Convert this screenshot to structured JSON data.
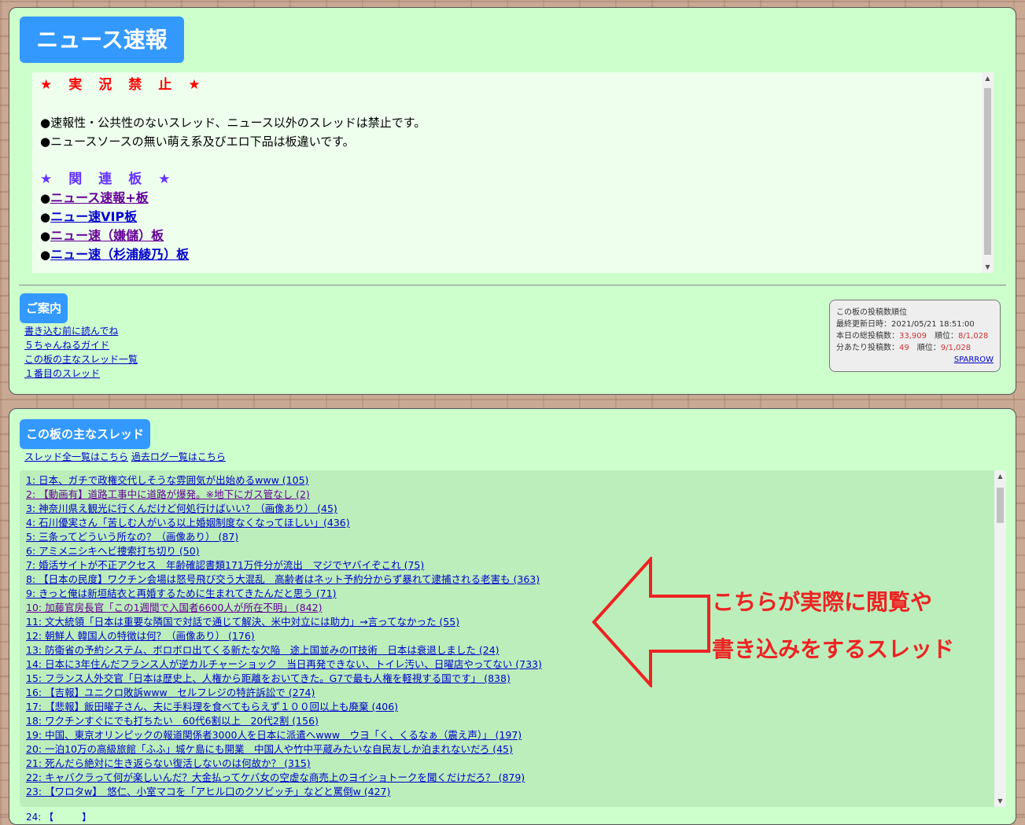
{
  "board": {
    "title": "ニュース速報"
  },
  "header": {
    "rule_heading": "★　実　況　禁　止　★",
    "rules": [
      "●速報性・公共性のないスレッド、ニュース以外のスレッドは禁止です。",
      "●ニュースソースの無い萌え系及びエロ下品は板違いです。"
    ],
    "related_heading": "★　関　連　板　★",
    "bullet": "●",
    "related_boards": [
      {
        "label": "ニュース速報+板",
        "visited": true
      },
      {
        "label": "ニュー速VIP板",
        "visited": false
      },
      {
        "label": "ニュー速（嫌儲）板",
        "visited": true
      },
      {
        "label": "ニュー速（杉浦綾乃）板",
        "visited": false
      }
    ]
  },
  "guide": {
    "title": "ご案内",
    "links": [
      "書き込む前に読んでね",
      "５ちゃんねるガイド",
      "この板の主なスレッド一覧",
      "１番目のスレッド"
    ]
  },
  "ranking": {
    "title": "この板の投稿数順位",
    "updated_label": "最終更新日時：",
    "updated": "2021/05/21 18:51:00",
    "today_label": "本日の総投稿数：",
    "today_value": "33,909",
    "rank_label": "順位：",
    "today_rank": "8/1,028",
    "per_min_label": "分あたり投稿数：",
    "per_min_value": "49",
    "per_min_rank": "9/1,028",
    "source": "SPARROW"
  },
  "threads": {
    "title": "この板の主なスレッド",
    "all_link": "スレッド全一覧はこちら",
    "log_link": "過去ログ一覧はこちら",
    "items": [
      {
        "text": "1: 日本、ガチで政権交代しそうな雰囲気が出始めるwww (105)",
        "visited": false
      },
      {
        "text": "2: 【動画有】道路工事中に道路が爆発。※地下にガス管なし (2)",
        "visited": true
      },
      {
        "text": "3: 神奈川県え観光に行くんだけど何処行けばいい？（画像あり） (45)",
        "visited": false
      },
      {
        "text": "4: 石川優実さん「苦しむ人がいる以上婚姻制度なくなってほしい」(436)",
        "visited": false
      },
      {
        "text": "5: 三条ってどういう所なの？（画像あり） (87)",
        "visited": false
      },
      {
        "text": "6: アミメニシキヘビ捜索打ち切り (50)",
        "visited": false
      },
      {
        "text": "7: 婚活サイトが不正アクセス　年齢確認書類171万件分が流出　マジでヤバイぞこれ (75)",
        "visited": false
      },
      {
        "text": "8: 【日本の民度】ワクチン会場は怒号飛び交う大混乱　高齢者はネット予約分からず暴れて逮捕される老害も (363)",
        "visited": false
      },
      {
        "text": "9: きっと俺は新垣結衣と再婚するために生まれてきたんだと思う (71)",
        "visited": false
      },
      {
        "text": "10: 加藤官房長官「この1週間で入国者6600人が所在不明」 (842)",
        "visited": true
      },
      {
        "text": "11: 文大統領「日本は重要な隣国で対話で通じて解決、米中対立には助力」→言ってなかった (55)",
        "visited": false
      },
      {
        "text": "12: 朝鮮人 韓国人の特徴は何？（画像あり） (176)",
        "visited": false
      },
      {
        "text": "13: 防衛省の予約システム、ボロボロ出てくる新たな欠陥　途上国並みのIT技術　日本は衰退しました (24)",
        "visited": false
      },
      {
        "text": "14: 日本に3年住んだフランス人が逆カルチャーショック　当日再発できない、トイレ汚い、日曜店やってない (733)",
        "visited": false
      },
      {
        "text": "15: フランス人外交官「日本は歴史上、人権から距離をおいてきた。G7で最も人権を軽視する国です」 (838)",
        "visited": false
      },
      {
        "text": "16: 【吉報】ユニクロ敗訴www　セルフレジの特許訴訟で (274)",
        "visited": false
      },
      {
        "text": "17: 【悲報】飯田曜子さん、夫に手料理を食べてもらえず１００回以上も廃棄 (406)",
        "visited": false
      },
      {
        "text": "18: ワクチンすぐにでも打ちたい　60代6割以上　20代2割 (156)",
        "visited": false
      },
      {
        "text": "19: 中国、東京オリンピックの報道関係者3000人を日本に派遣へwww　ウヨ「く、くるなぁ（震え声）」 (197)",
        "visited": false
      },
      {
        "text": "20: 一泊10万の高級旅館「ふふ」城ケ島にも開業　中国人や竹中平蔵みたいな自民友しか泊まれないだろ (45)",
        "visited": false
      },
      {
        "text": "21: 死んだら絶対に生き返らない復活しないのは何故か？ (315)",
        "visited": false
      },
      {
        "text": "22: キャバクラって何が楽しいんだ？大金払ってケバ女の空虚な商売上のヨイショトークを聞くだけだろ？ (879)",
        "visited": false
      },
      {
        "text": "23: 【ワロタw】　悠仁、小室マコを「アヒル口のクソビッチ」などと罵倒w (427)",
        "visited": false
      }
    ],
    "clipped_next": "24: 【　　　】"
  },
  "annotation": {
    "line1": "こちらが実際に閲覧や",
    "line2": "書き込みをするスレッド",
    "color": "#ee2222"
  },
  "scroll_up_icon": "▲",
  "scroll_down_icon": "▼"
}
